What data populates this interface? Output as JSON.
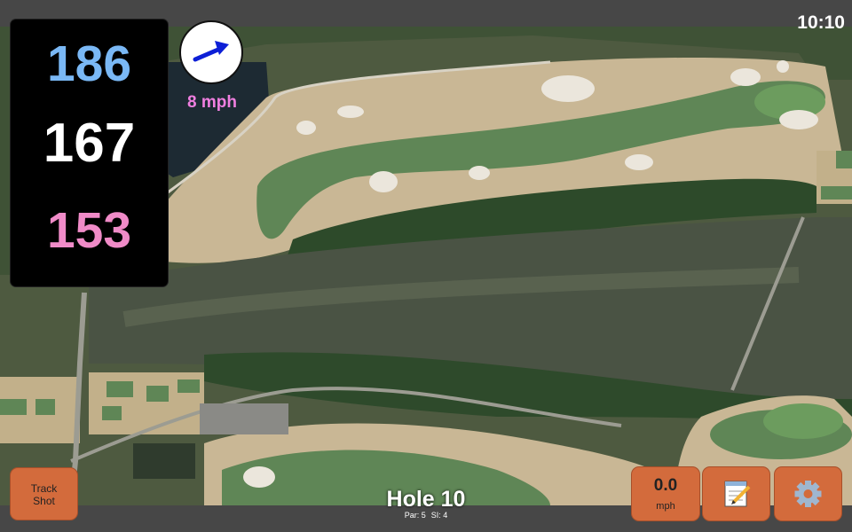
{
  "status": {
    "time": "10:10"
  },
  "distances": {
    "back": "186",
    "middle": "167",
    "front": "153"
  },
  "colors": {
    "back": "#7ab8f5",
    "middle": "#ffffff",
    "front": "#f08bc8",
    "wind_text": "#f07fe0",
    "button": "#d36b3c",
    "arrow": "#0d1fd6"
  },
  "wind": {
    "speed": "8 mph",
    "icon": "wind-direction-arrow-icon"
  },
  "buttons": {
    "track_shot_line1": "Track",
    "track_shot_line2": "Shot",
    "speed_value": "0.0",
    "speed_unit": "mph",
    "notes_icon": "notepad-icon",
    "settings_icon": "gear-icon"
  },
  "hole": {
    "title": "Hole 10",
    "par": "Par: 5",
    "si": "SI: 4"
  }
}
